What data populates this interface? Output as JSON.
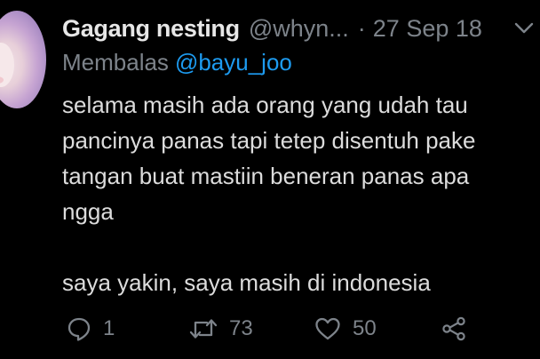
{
  "tweet": {
    "author": {
      "display_name": "Gagang nesting",
      "handle": "@whyn..."
    },
    "separator": "·",
    "date": "27 Sep 18",
    "reply_to": {
      "prefix": "Membalas",
      "mention": "@bayu_joo"
    },
    "text_lines": [
      "selama masih ada orang yang udah tau",
      "pancinya panas tapi tetep disentuh pake",
      "tangan buat mastiin beneran panas apa",
      "ngga",
      "",
      "saya yakin, saya masih di indonesia"
    ],
    "actions": {
      "reply_count": "1",
      "retweet_count": "73",
      "like_count": "50"
    },
    "icons": {
      "avatar": "avatar-image",
      "menu": "chevron-down-icon",
      "reply": "reply-icon",
      "retweet": "retweet-icon",
      "like": "heart-icon",
      "share": "share-icon"
    }
  },
  "colors": {
    "background": "#000000",
    "primary_text": "#e7e7e7",
    "secondary_text": "#7d838a",
    "link": "#1d9bf0"
  }
}
